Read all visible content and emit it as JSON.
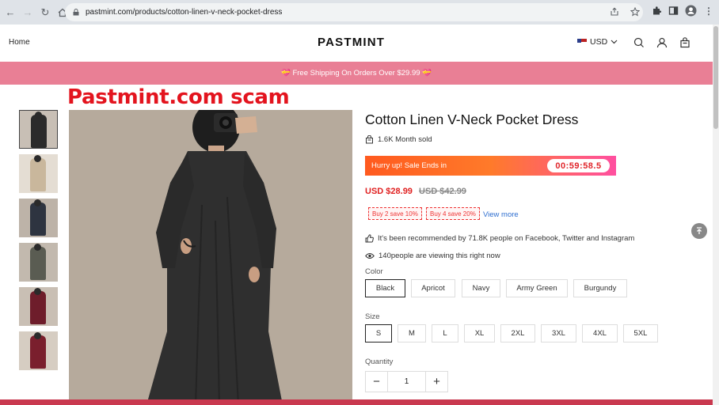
{
  "browser": {
    "url": "pastmint.com/products/cotton-linen-v-neck-pocket-dress"
  },
  "header": {
    "home_label": "Home",
    "logo": "PASTMINT",
    "currency": "USD"
  },
  "announcement": "💝 Free Shipping On Orders Over $29.99 💝",
  "overlay_title": "Pastmint.com scam",
  "product": {
    "title": "Cotton Linen V-Neck Pocket Dress",
    "sold": "1.6K Month sold",
    "sale_text": "Hurry up! Sale Ends in",
    "timer": "00:59:58.5",
    "price": "USD $28.99",
    "old_price": "USD $42.99",
    "promos": [
      "Buy 2 save 10%",
      "Buy 4 save 20%"
    ],
    "view_more": "View more",
    "recommended": "It's been recommended by 71.8K people on Facebook, Twitter and Instagram",
    "viewing": "140people are viewing this right now",
    "color_label": "Color",
    "colors": [
      "Black",
      "Apricot",
      "Navy",
      "Army Green",
      "Burgundy"
    ],
    "selected_color": "Black",
    "size_label": "Size",
    "sizes": [
      "S",
      "M",
      "L",
      "XL",
      "2XL",
      "3XL",
      "4XL",
      "5XL"
    ],
    "selected_size": "S",
    "quantity_label": "Quantity",
    "quantity": "1"
  },
  "thumbnail_colors": [
    "#2b2b2b",
    "#c9b79c",
    "#2e3440",
    "#5a5c52",
    "#6e1d2b",
    "#7a1f2d"
  ],
  "colors": {
    "announcement_bg": "#e97f95",
    "scam_title": "#e3141e",
    "price": "#e02020",
    "link": "#2f6fd0"
  }
}
